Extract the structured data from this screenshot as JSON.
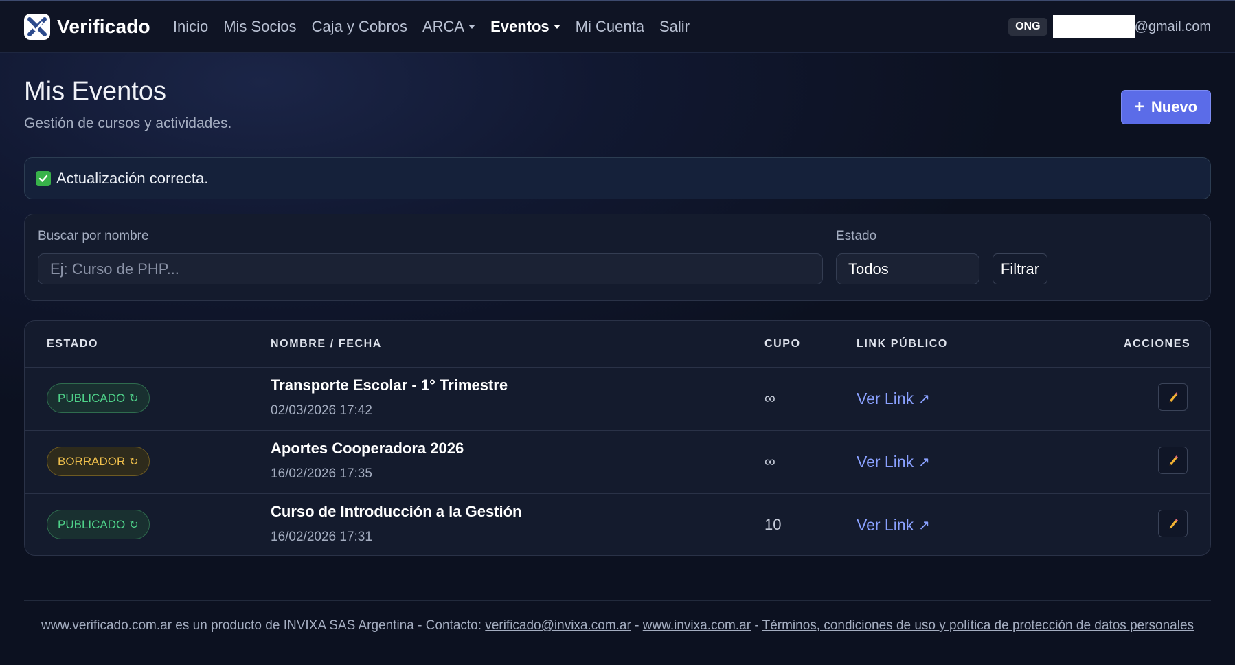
{
  "brand": {
    "name": "Verificado"
  },
  "nav": {
    "items": [
      {
        "label": "Inicio",
        "dropdown": false,
        "active": false
      },
      {
        "label": "Mis Socios",
        "dropdown": false,
        "active": false
      },
      {
        "label": "Caja y Cobros",
        "dropdown": false,
        "active": false
      },
      {
        "label": "ARCA",
        "dropdown": true,
        "active": false
      },
      {
        "label": "Eventos",
        "dropdown": true,
        "active": true
      },
      {
        "label": "Mi Cuenta",
        "dropdown": false,
        "active": false
      },
      {
        "label": "Salir",
        "dropdown": false,
        "active": false
      }
    ],
    "org_badge": "ONG",
    "email_suffix": "@gmail.com"
  },
  "header": {
    "title": "Mis Eventos",
    "subtitle": "Gestión de cursos y actividades.",
    "new_button_icon": "+",
    "new_button_label": "Nuevo"
  },
  "alert": {
    "message": "Actualización correcta."
  },
  "filters": {
    "search_label": "Buscar por nombre",
    "search_placeholder": "Ej: Curso de PHP...",
    "status_label": "Estado",
    "status_value": "Todos",
    "filter_button": "Filtrar"
  },
  "table": {
    "headers": {
      "estado": "ESTADO",
      "nombre": "NOMBRE / FECHA",
      "cupo": "CUPO",
      "link": "LINK PÚBLICO",
      "acciones": "ACCIONES"
    },
    "rows": [
      {
        "status": "PUBLICADO",
        "status_kind": "published",
        "name": "Transporte Escolar - 1° Trimestre",
        "date": "02/03/2026 17:42",
        "cupo": "∞",
        "link_label": "Ver Link",
        "link_icon": "↗"
      },
      {
        "status": "BORRADOR",
        "status_kind": "draft",
        "name": "Aportes Cooperadora 2026",
        "date": "16/02/2026 17:35",
        "cupo": "∞",
        "link_label": "Ver Link",
        "link_icon": "↗"
      },
      {
        "status": "PUBLICADO",
        "status_kind": "published",
        "name": "Curso de Introducción a la Gestión",
        "date": "16/02/2026 17:31",
        "cupo": "10",
        "link_label": "Ver Link",
        "link_icon": "↗"
      }
    ],
    "refresh_icon": "↻",
    "edit_icon": "pencil-icon"
  },
  "footer": {
    "prefix": "www.verificado.com.ar es un producto de INVIXA SAS Argentina - Contacto: ",
    "contact_email": "verificado@invixa.com.ar",
    "sep1": " - ",
    "site": "www.invixa.com.ar",
    "sep2": " - ",
    "terms": "Términos, condiciones de uso y política de protección de datos personales"
  },
  "colors": {
    "accent": "#5b6ce8",
    "link": "#8aa1ff",
    "published": "#4fd38a",
    "draft": "#f0c04c",
    "success": "#38b24a"
  }
}
